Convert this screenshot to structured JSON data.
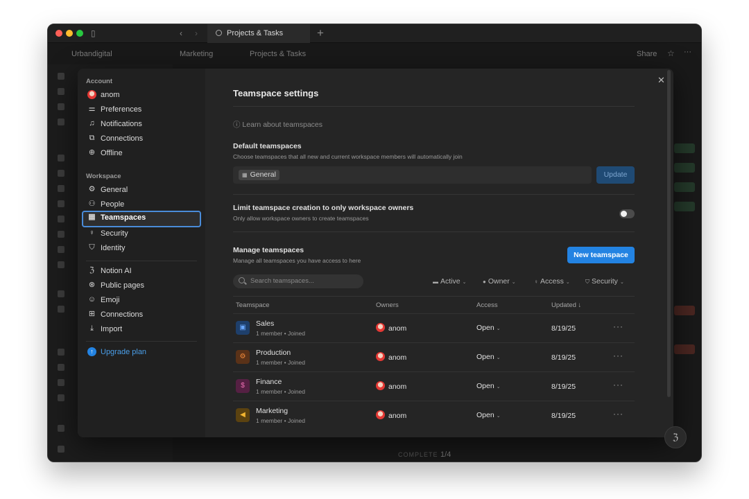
{
  "titlebar": {
    "tab_title": "Projects & Tasks"
  },
  "appbar": {
    "workspace": "Urbandigital",
    "breadcrumb_parent": "Marketing",
    "breadcrumb_current": "Projects & Tasks",
    "share_label": "Share"
  },
  "modal": {
    "account_title": "Account",
    "account_items": [
      {
        "label": "anom",
        "icon": "avatar"
      },
      {
        "label": "Preferences",
        "icon": "sliders-icon"
      },
      {
        "label": "Notifications",
        "icon": "bell-icon"
      },
      {
        "label": "Connections",
        "icon": "external-link-icon"
      },
      {
        "label": "Offline",
        "icon": "download-circle-icon"
      }
    ],
    "workspace_title": "Workspace",
    "workspace_items": [
      {
        "label": "General",
        "icon": "gear-icon"
      },
      {
        "label": "People",
        "icon": "people-icon"
      },
      {
        "label": "Teamspaces",
        "icon": "building-icon"
      },
      {
        "label": "Security",
        "icon": "key-icon"
      },
      {
        "label": "Identity",
        "icon": "shield-icon"
      }
    ],
    "more_items": [
      {
        "label": "Notion AI",
        "icon": "ai-face-icon"
      },
      {
        "label": "Public pages",
        "icon": "globe-icon"
      },
      {
        "label": "Emoji",
        "icon": "smile-icon"
      },
      {
        "label": "Connections",
        "icon": "grid-icon"
      },
      {
        "label": "Import",
        "icon": "import-icon"
      }
    ],
    "upgrade_label": "Upgrade plan"
  },
  "settings": {
    "title": "Teamspace settings",
    "learn_link": "Learn about teamspaces",
    "default_label": "Default teamspaces",
    "default_desc": "Choose teamspaces that all new and current workspace members will automatically join",
    "default_chip": "General",
    "update_label": "Update",
    "limit_label": "Limit teamspace creation to only workspace owners",
    "limit_desc": "Only allow workspace owners to create teamspaces",
    "limit_enabled": false,
    "manage_label": "Manage teamspaces",
    "manage_desc": "Manage all teamspaces you have access to here",
    "new_label": "New teamspace",
    "search_placeholder": "Search teamspaces...",
    "filters": {
      "active": "Active",
      "owner": "Owner",
      "access": "Access",
      "security": "Security"
    },
    "columns": {
      "teamspace": "Teamspace",
      "owners": "Owners",
      "access": "Access",
      "updated": "Updated ↓"
    },
    "rows": [
      {
        "name": "Sales",
        "meta": "1 member • Joined",
        "owner": "anom",
        "access": "Open",
        "updated": "8/19/25",
        "icon": "store-icon",
        "color": "#2f6fd0"
      },
      {
        "name": "Production",
        "meta": "1 member • Joined",
        "owner": "anom",
        "access": "Open",
        "updated": "8/19/25",
        "icon": "gears-icon",
        "color": "#c8631c"
      },
      {
        "name": "Finance",
        "meta": "1 member • Joined",
        "owner": "anom",
        "access": "Open",
        "updated": "8/19/25",
        "icon": "money-icon",
        "color": "#b8377a"
      },
      {
        "name": "Marketing",
        "meta": "1 member • Joined",
        "owner": "anom",
        "access": "Open",
        "updated": "8/19/25",
        "icon": "megaphone-icon",
        "color": "#c98a14"
      }
    ]
  },
  "footer": {
    "progress_label": "COMPLETE",
    "progress_value": "1/4"
  }
}
